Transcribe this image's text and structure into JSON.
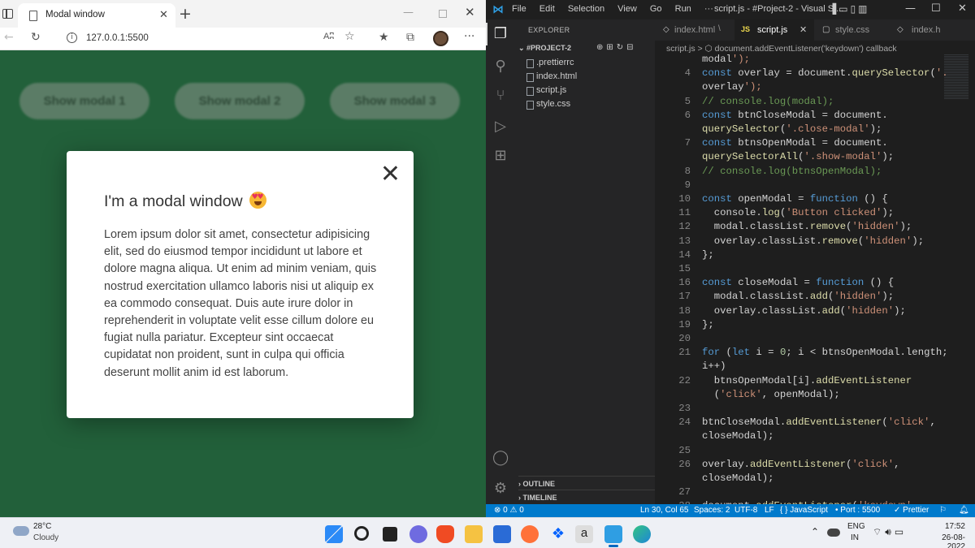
{
  "browser": {
    "tab_title": "Modal window",
    "url": "127.0.0.1:5500",
    "read_aloud": "Aʭ",
    "buttons": [
      "Show modal 1",
      "Show modal 2",
      "Show modal 3"
    ],
    "modal": {
      "close": "✕",
      "title": "I'm a modal window",
      "body": "Lorem ipsum dolor sit amet, consectetur adipisicing elit, sed do eiusmod tempor incididunt ut labore et dolore magna aliqua. Ut enim ad minim veniam, quis nostrud exercitation ullamco laboris nisi ut aliquip ex ea commodo consequat. Duis aute irure dolor in reprehenderit in voluptate velit esse cillum dolore eu fugiat nulla pariatur. Excepteur sint occaecat cupidatat non proident, sunt in culpa qui officia deserunt mollit anim id est laborum."
    }
  },
  "vscode": {
    "menu": [
      "File",
      "Edit",
      "Selection",
      "View",
      "Go",
      "Run",
      "···"
    ],
    "window_title": "script.js - #Project-2 - Visual St...",
    "explorer_title": "EXPLORER",
    "project": "#PROJECT-2",
    "files": [
      ".prettierrc",
      "index.html",
      "script.js",
      "style.css"
    ],
    "sections": {
      "outline": "OUTLINE",
      "timeline": "TIMELINE"
    },
    "tabs": [
      "index.html",
      "script.js",
      "style.css",
      "index.h"
    ],
    "breadcrumb": "script.js > ⬡ document.addEventListener('keydown') callback",
    "code_lines": [
      {
        "num": "",
        "text": "modal');"
      },
      {
        "num": "4",
        "text": "const overlay = document.querySelector('."
      },
      {
        "num": "",
        "text": "overlay');"
      },
      {
        "num": "5",
        "text": "// console.log(modal);"
      },
      {
        "num": "6",
        "text": "const btnCloseModal = document."
      },
      {
        "num": "",
        "text": "querySelector('.close-modal');"
      },
      {
        "num": "7",
        "text": "const btnsOpenModal = document."
      },
      {
        "num": "",
        "text": "querySelectorAll('.show-modal');"
      },
      {
        "num": "8",
        "text": "// console.log(btnsOpenModal);"
      },
      {
        "num": "9",
        "text": ""
      },
      {
        "num": "10",
        "text": "const openModal = function () {"
      },
      {
        "num": "11",
        "text": "  console.log('Button clicked');"
      },
      {
        "num": "12",
        "text": "  modal.classList.remove('hidden');"
      },
      {
        "num": "13",
        "text": "  overlay.classList.remove('hidden');"
      },
      {
        "num": "14",
        "text": "};"
      },
      {
        "num": "15",
        "text": ""
      },
      {
        "num": "16",
        "text": "const closeModal = function () {"
      },
      {
        "num": "17",
        "text": "  modal.classList.add('hidden');"
      },
      {
        "num": "18",
        "text": "  overlay.classList.add('hidden');"
      },
      {
        "num": "19",
        "text": "};"
      },
      {
        "num": "20",
        "text": ""
      },
      {
        "num": "21",
        "text": "for (let i = 0; i < btnsOpenModal.length;"
      },
      {
        "num": "",
        "text": "i++)"
      },
      {
        "num": "22",
        "text": "  btnsOpenModal[i].addEventListener"
      },
      {
        "num": "",
        "text": "  ('click', openModal);"
      },
      {
        "num": "23",
        "text": ""
      },
      {
        "num": "24",
        "text": "btnCloseModal.addEventListener('click',"
      },
      {
        "num": "",
        "text": "closeModal);"
      },
      {
        "num": "25",
        "text": ""
      },
      {
        "num": "26",
        "text": "overlay.addEventListener('click',"
      },
      {
        "num": "",
        "text": "closeModal);"
      },
      {
        "num": "27",
        "text": ""
      },
      {
        "num": "28",
        "text": "document.addEventListener('keydown',"
      }
    ],
    "status": {
      "problems": "⊗ 0 ⚠ 0",
      "position": "Ln 30, Col 65",
      "spaces": "Spaces: 2",
      "encoding": "UTF-8",
      "eol": "LF",
      "language": "{ } JavaScript",
      "port": "• Port : 5500",
      "prettier": "✓ Prettier"
    }
  },
  "taskbar": {
    "temperature": "28°C",
    "condition": "Cloudy",
    "lang_1": "ENG",
    "lang_2": "IN",
    "time": "17:52",
    "date": "26-08-2022"
  },
  "colors": {
    "overlay_green": "#22603a",
    "vscode_bg": "#1e1e1e",
    "status_blue": "#007acc"
  }
}
